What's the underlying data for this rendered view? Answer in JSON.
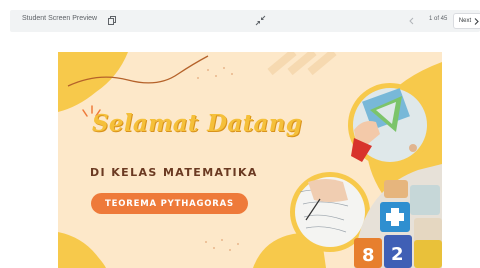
{
  "toolbar": {
    "title": "Student Screen Preview",
    "page_counter": "1 of 45",
    "next_label": "Next",
    "icons": [
      "copy-icon",
      "collapse-icon",
      "chevron-left-icon",
      "chevron-right-icon"
    ]
  },
  "slide": {
    "heading": "Selamat Datang",
    "subheading": "DI KELAS MATEMATIKA",
    "pill_label": "TEOREMA PYTHAGORAS",
    "colors": {
      "background": "#fde8c9",
      "heading": "#f5c03a",
      "subheading": "#6b3a22",
      "pill": "#ee7a3a",
      "blob": "#f7c94b"
    },
    "decorations": [
      "wavy-line",
      "sparkle-lines",
      "photo-hand-triangle",
      "photo-hand-writing",
      "photo-number-blocks"
    ]
  }
}
